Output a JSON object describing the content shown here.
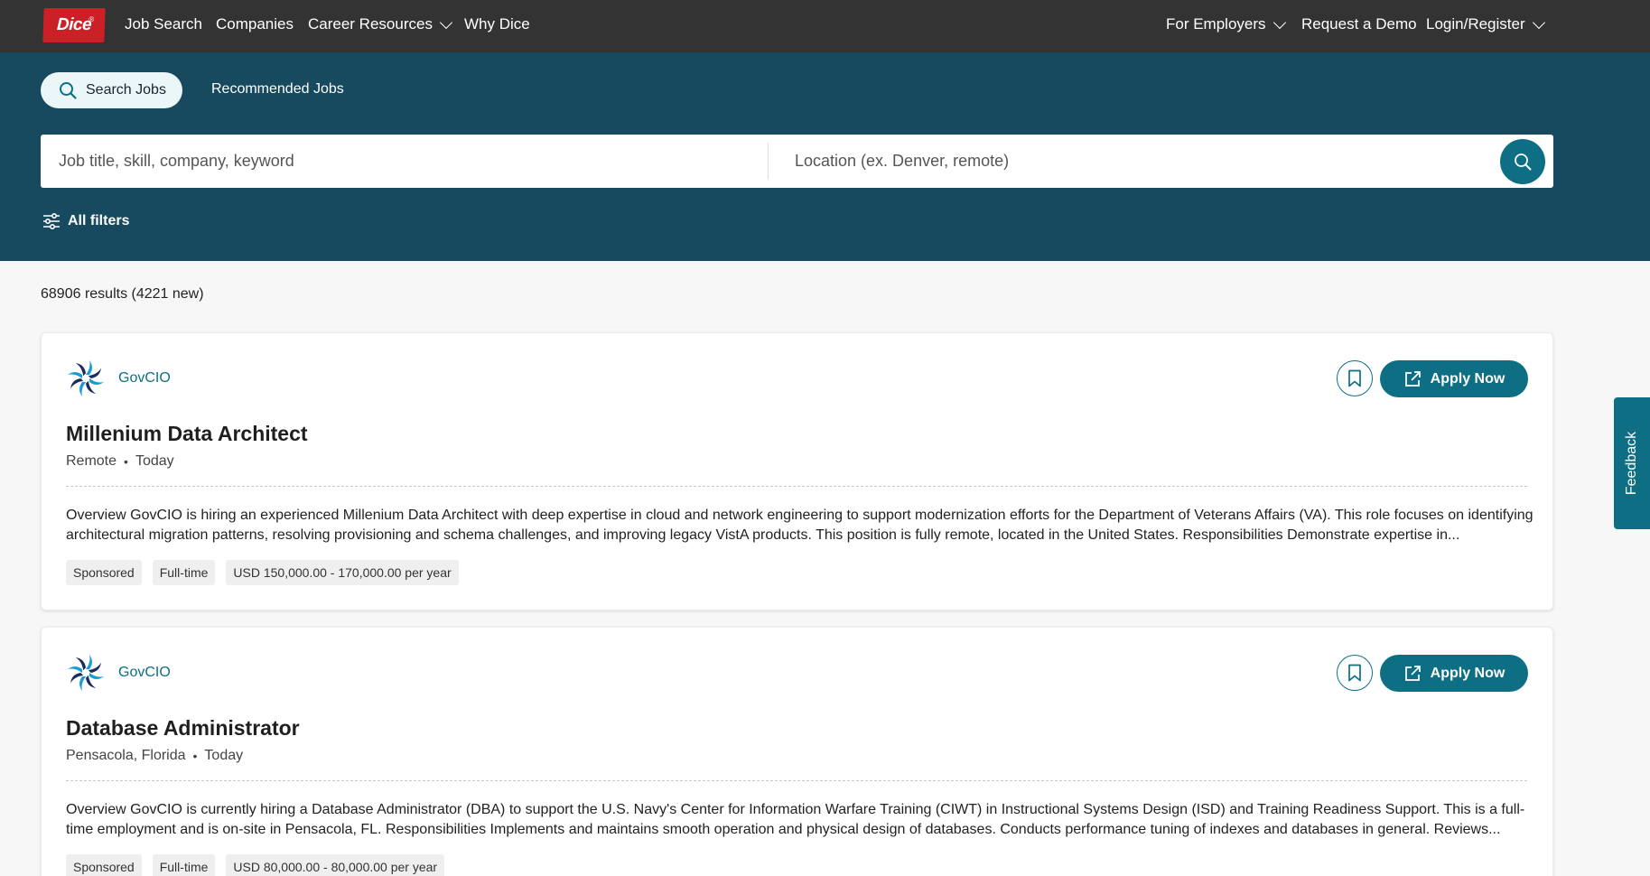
{
  "nav": {
    "logo_text": "Dice",
    "links": [
      "Job Search",
      "Companies",
      "Career Resources",
      "Why Dice"
    ],
    "right_links": [
      "For Employers",
      "Request a Demo",
      "Login/Register"
    ]
  },
  "search": {
    "tab_active": "Search Jobs",
    "tab_other": "Recommended Jobs",
    "keyword_placeholder": "Job title, skill, company, keyword",
    "location_placeholder": "Location (ex. Denver, remote)",
    "filters_label": "All filters"
  },
  "results": {
    "count_text": "68906 results (4221 new)"
  },
  "jobs": [
    {
      "company": "GovCIO",
      "title": "Millenium Data Architect",
      "location": "Remote",
      "posted": "Today",
      "description": "Overview GovCIO is hiring an experienced Millenium Data Architect with deep expertise in cloud and network engineering to support modernization efforts for the Department of Veterans Affairs (VA). This role focuses on identifying architectural migration patterns, resolving provisioning and schema challenges, and improving legacy VistA products. This position is fully remote, located in the United States. Responsibilities Demonstrate expertise in...",
      "tags": [
        "Sponsored",
        "Full-time",
        "USD 150,000.00 - 170,000.00 per year"
      ],
      "apply_label": "Apply Now"
    },
    {
      "company": "GovCIO",
      "title": "Database Administrator",
      "location": "Pensacola, Florida",
      "posted": "Today",
      "description": "Overview GovCIO is currently hiring a Database Administrator (DBA) to support the U.S. Navy's Center for Information Warfare Training (CIWT) in Instructional Systems Design (ISD) and Training Readiness Support. This is a full-time employment and is on-site in Pensacola, FL. Responsibilities Implements and maintains smooth operation and physical design of databases. Conducts performance tuning of indexes and databases in general. Reviews...",
      "tags": [
        "Sponsored",
        "Full-time",
        "USD 80,000.00 - 80,000.00 per year"
      ],
      "apply_label": "Apply Now"
    }
  ],
  "feedback_label": "Feedback",
  "colors": {
    "nav_bg": "#333333",
    "band_bg": "#17495f",
    "accent": "#0e6f84",
    "logo_red": "#cc2027"
  }
}
